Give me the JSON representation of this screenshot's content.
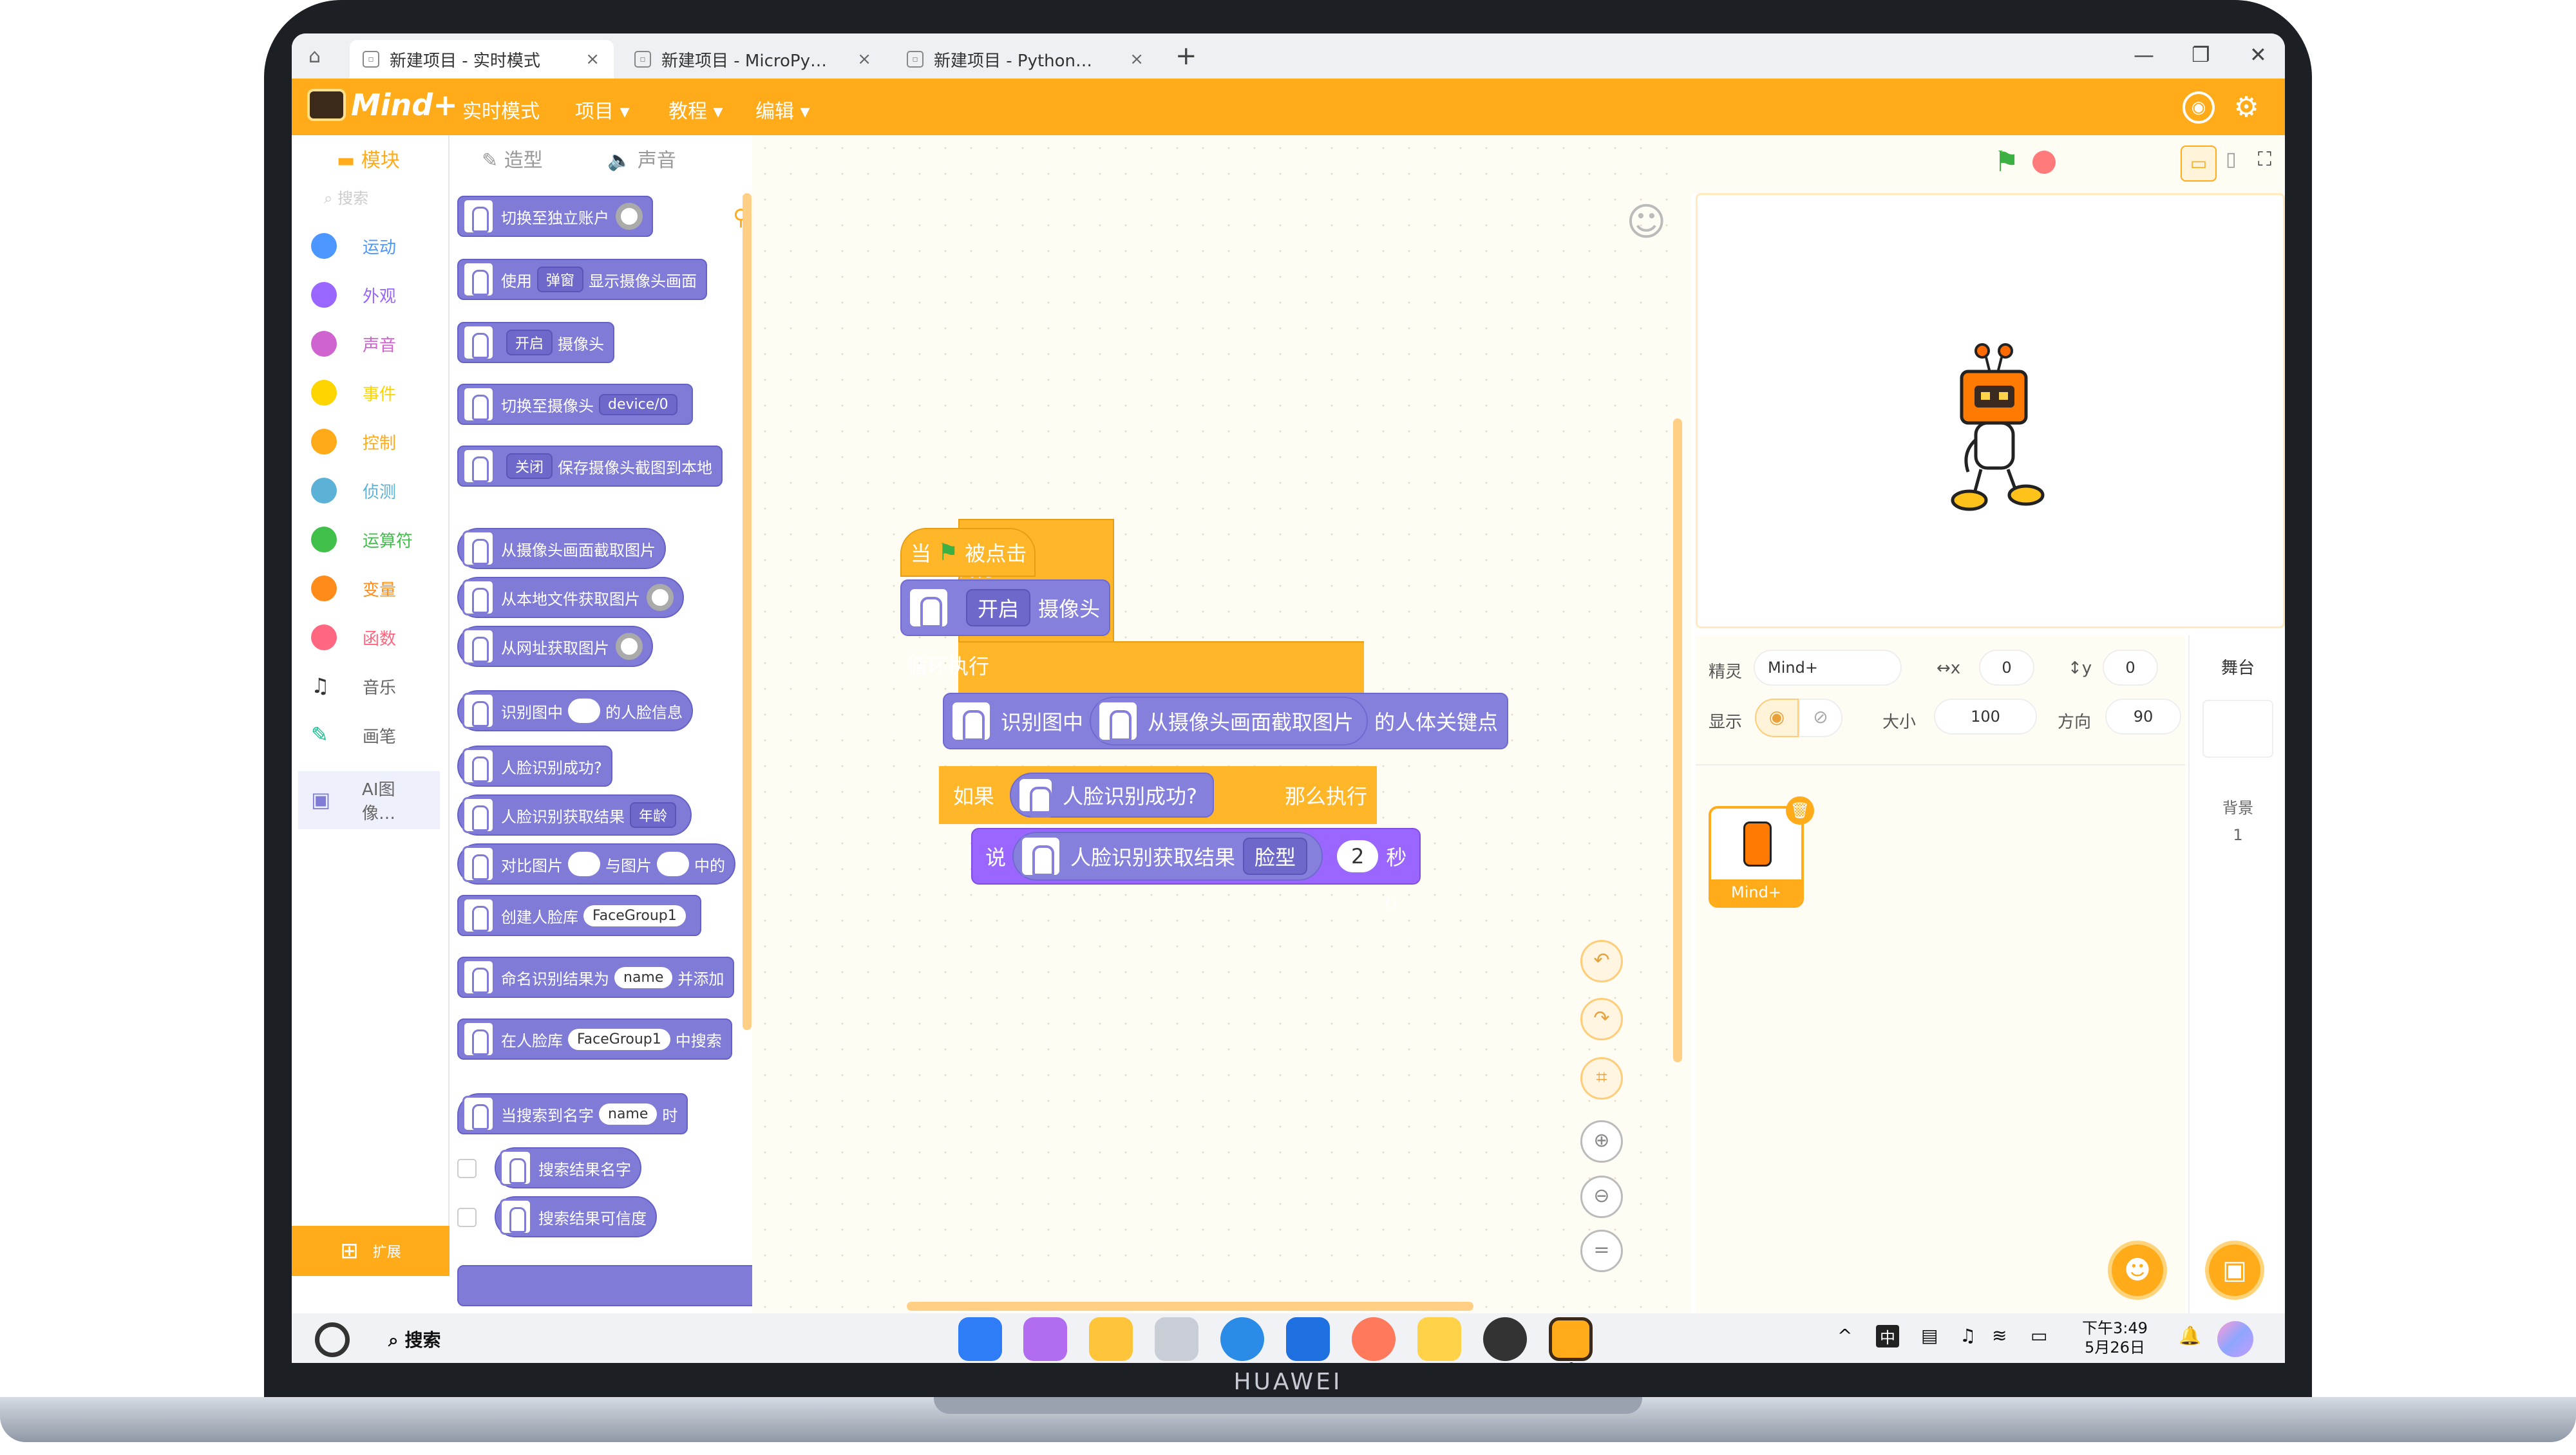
{
  "tabs": [
    {
      "label": "新建项目 - 实时模式",
      "active": true
    },
    {
      "label": "新建项目 - MicroPy…",
      "active": false
    },
    {
      "label": "新建项目 - Python…",
      "active": false
    }
  ],
  "tab_close": "×",
  "new_tab": "+",
  "window_controls": {
    "minimize": "—",
    "restore": "❐",
    "close": "✕"
  },
  "menubar": {
    "logo": "Mind+",
    "items": [
      "实时模式",
      "项目 ▾",
      "教程 ▾",
      "编辑 ▾"
    ]
  },
  "sidebar": {
    "tabs": [
      "模块",
      "造型",
      "声音"
    ],
    "search_placeholder": "搜索",
    "categories": [
      {
        "label": "运动",
        "color": "#4c97ff"
      },
      {
        "label": "外观",
        "color": "#9966ff"
      },
      {
        "label": "声音",
        "color": "#cf63cf"
      },
      {
        "label": "事件",
        "color": "#ffd500"
      },
      {
        "label": "控制",
        "color": "#ffab19"
      },
      {
        "label": "侦测",
        "color": "#5cb1d6"
      },
      {
        "label": "运算符",
        "color": "#40bf4a"
      },
      {
        "label": "变量",
        "color": "#ff8c1a"
      },
      {
        "label": "函数",
        "color": "#ff6680"
      },
      {
        "label": "音乐",
        "color": "#333333"
      },
      {
        "label": "画笔",
        "color": "#0fbd8c"
      },
      {
        "label": "AI图像…",
        "color": "#7f7bd7"
      }
    ],
    "extensions_label": "扩展"
  },
  "palette": {
    "b1": "切换至独立账户",
    "b2_pre": "使用",
    "b2_dd": "弹窗",
    "b2_post": "显示摄像头画面",
    "b3_dd": "开启",
    "b3_post": "摄像头",
    "b4_pre": "切换至摄像头",
    "b4_dd": "device/0",
    "b5_dd": "关闭",
    "b5_post": "保存摄像头截图到本地",
    "b6": "从摄像头画面截取图片",
    "b7": "从本地文件获取图片",
    "b8": "从网址获取图片",
    "b9_pre": "识别图中",
    "b9_post": "的人脸信息",
    "b10": "人脸识别成功?",
    "b11_pre": "人脸识别获取结果",
    "b11_dd": "年龄",
    "b12_pre": "对比图片",
    "b12_mid": "与图片",
    "b12_post": "中的",
    "b13_pre": "创建人脸库",
    "b13_slot": "FaceGroup1",
    "b14_pre": "命名识别结果为",
    "b14_slot": "name",
    "b14_post": "并添加",
    "b15_pre": "在人脸库",
    "b15_slot": "FaceGroup1",
    "b15_post": "中搜索",
    "b16_pre": "当搜索到名字",
    "b16_slot": "name",
    "b16_post": "时",
    "b17": "搜索结果名字",
    "b18": "搜索结果可信度"
  },
  "workspace": {
    "hat_when": "当",
    "hat_clicked": "被点击",
    "cam_dd": "开启",
    "cam_post": "摄像头",
    "loop": "循环执行",
    "recog_pre": "识别图中",
    "recog_inner": "从摄像头画面截取图片",
    "recog_post": "的人体关键点",
    "if_label": "如果",
    "if_cond": "人脸识别成功?",
    "if_then": "那么执行",
    "say": "说",
    "say_inner": "人脸识别获取结果",
    "say_dd": "脸型",
    "say_secs": "2",
    "say_unit": "秒",
    "zoom_reset": "="
  },
  "sprite_panel": {
    "sprite_label": "精灵",
    "sprite_name": "Mind+",
    "x_label": "↔x",
    "x_value": "0",
    "y_label": "↕y",
    "y_value": "0",
    "show_label": "显示",
    "size_label": "大小",
    "size_value": "100",
    "dir_label": "方向",
    "dir_value": "90",
    "thumb_name": "Mind+"
  },
  "stage_col": {
    "title": "舞台",
    "bg_label": "背景",
    "bg_count": "1"
  },
  "taskbar": {
    "search": "搜索",
    "time": "下午3:49",
    "date": "5月26日",
    "ime": "中"
  },
  "laptop_brand": "HUAWEI",
  "colors": {
    "accent": "#ffab1a",
    "ai_block": "#7f7bd7",
    "control": "#ffb628"
  }
}
